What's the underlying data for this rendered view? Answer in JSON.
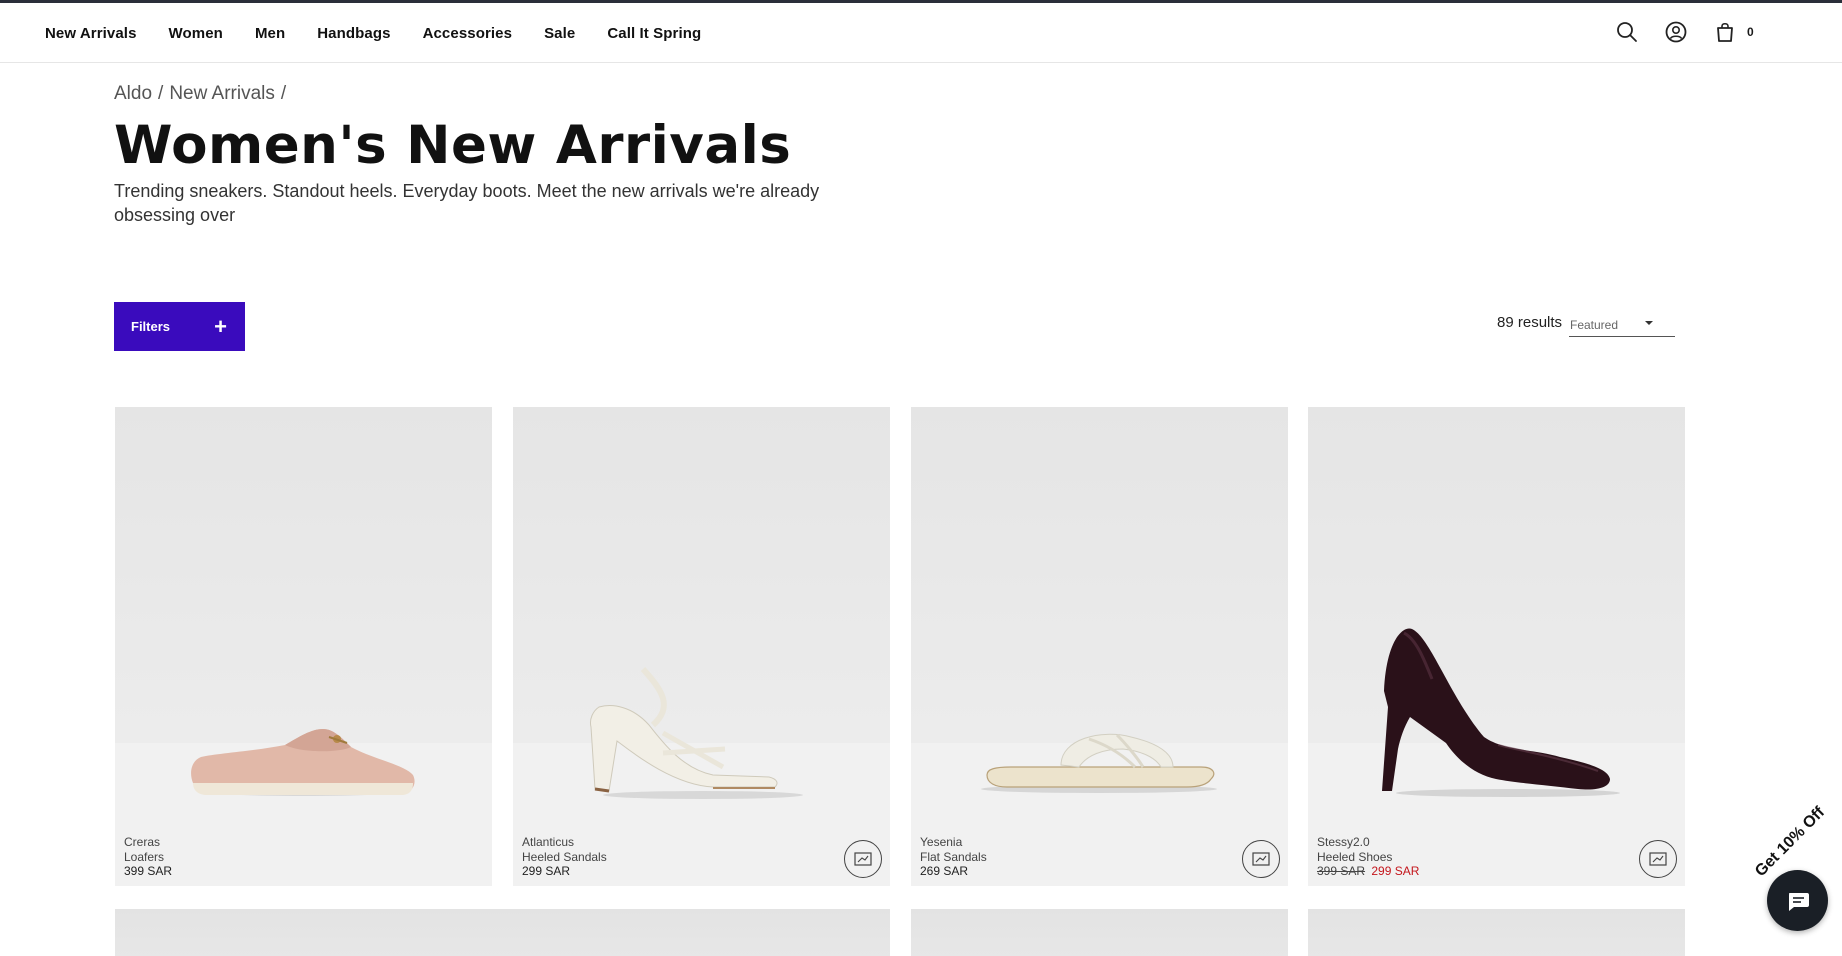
{
  "nav": {
    "items": [
      {
        "label": "New Arrivals"
      },
      {
        "label": "Women"
      },
      {
        "label": "Men"
      },
      {
        "label": "Handbags"
      },
      {
        "label": "Accessories"
      },
      {
        "label": "Sale"
      },
      {
        "label": "Call It Spring"
      }
    ],
    "cart_count": "0",
    "icons": [
      "search-icon",
      "account-icon",
      "cart-icon"
    ]
  },
  "breadcrumb": {
    "items": [
      "Aldo",
      "New Arrivals"
    ],
    "separator": "/"
  },
  "page": {
    "title": "Women's New Arrivals",
    "description": "Trending sneakers. Standout heels. Everyday boots. Meet the new arrivals we're already obsessing over"
  },
  "toolbar": {
    "filters_label": "Filters",
    "results_count": "89 results",
    "sort_selected": "Featured"
  },
  "products": [
    {
      "name": "Creras",
      "category": "Loafers",
      "price": "399 SAR",
      "original_price": "",
      "sale_price": "",
      "has_badge": false
    },
    {
      "name": "Atlanticus",
      "category": "Heeled Sandals",
      "price": "299 SAR",
      "original_price": "",
      "sale_price": "",
      "has_badge": true
    },
    {
      "name": "Yesenia",
      "category": "Flat Sandals",
      "price": "269 SAR",
      "original_price": "",
      "sale_price": "",
      "has_badge": true
    },
    {
      "name": "Stessy2.0",
      "category": "Heeled Shoes",
      "price": "",
      "original_price": "399 SAR",
      "sale_price": "299 SAR",
      "has_badge": true
    }
  ],
  "promo": {
    "tab_label": "Get 10% Off"
  },
  "colors": {
    "accent": "#3a0bbd",
    "sale": "#c4161c",
    "chat": "#1a1f26"
  }
}
